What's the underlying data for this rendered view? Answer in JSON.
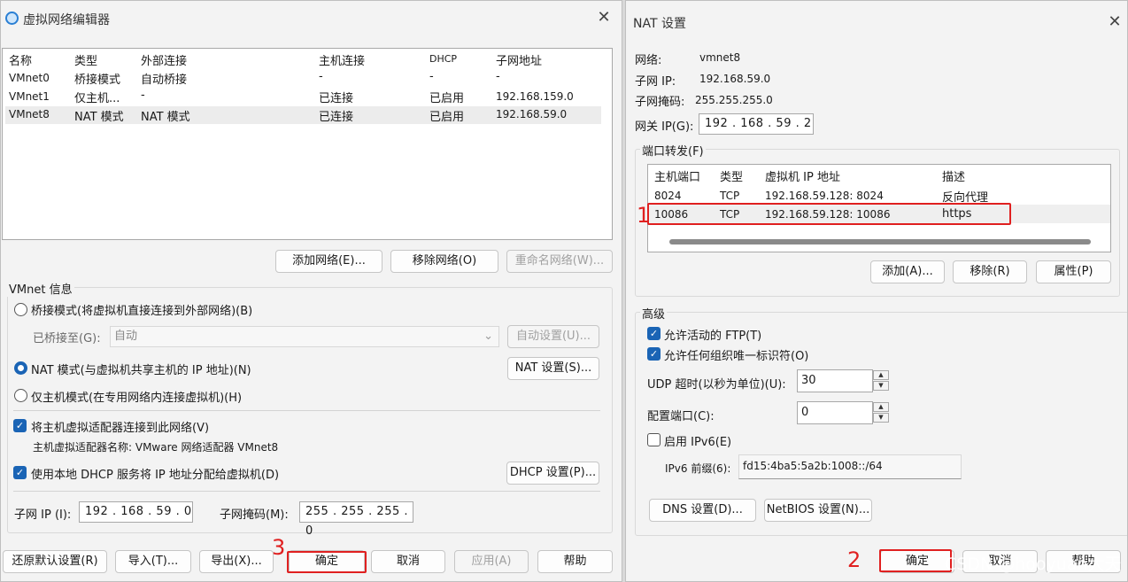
{
  "left": {
    "title": "虚拟网络编辑器",
    "columns": [
      "名称",
      "类型",
      "外部连接",
      "主机连接",
      "DHCP",
      "子网地址"
    ],
    "rows": [
      [
        "VMnet0",
        "桥接模式",
        "自动桥接",
        "-",
        "-",
        "-"
      ],
      [
        "VMnet1",
        "仅主机...",
        "-",
        "已连接",
        "已启用",
        "192.168.159.0"
      ],
      [
        "VMnet8",
        "NAT 模式",
        "NAT 模式",
        "已连接",
        "已启用",
        "192.168.59.0"
      ]
    ],
    "add_network": "添加网络(E)...",
    "remove_network": "移除网络(O)",
    "rename_network": "重命名网络(W)...",
    "vmnet_info": "VMnet 信息",
    "bridge_mode": "桥接模式(将虚拟机直接连接到外部网络)(B)",
    "bridged_to_label": "已桥接至(G):",
    "bridged_to_value": "自动",
    "auto_settings": "自动设置(U)...",
    "nat_mode": "NAT 模式(与虚拟机共享主机的 IP 地址)(N)",
    "nat_settings": "NAT 设置(S)...",
    "host_only_mode": "仅主机模式(在专用网络内连接虚拟机)(H)",
    "connect_host_adapter": "将主机虚拟适配器连接到此网络(V)",
    "host_adapter_name": "主机虚拟适配器名称: VMware 网络适配器 VMnet8",
    "use_dhcp": "使用本地 DHCP 服务将 IP 地址分配给虚拟机(D)",
    "dhcp_settings": "DHCP 设置(P)...",
    "subnet_ip_label": "子网 IP (I):",
    "subnet_ip": "192 . 168 . 59 . 0",
    "subnet_mask_label": "子网掩码(M):",
    "subnet_mask": "255 . 255 . 255 . 0",
    "restore_defaults": "还原默认设置(R)",
    "import": "导入(T)...",
    "export": "导出(X)...",
    "ok": "确定",
    "cancel": "取消",
    "apply": "应用(A)",
    "help": "帮助"
  },
  "right": {
    "title": "NAT 设置",
    "network_label": "网络:",
    "network_value": "vmnet8",
    "subnet_ip_label": "子网 IP:",
    "subnet_ip_value": "192.168.59.0",
    "subnet_mask_label": "子网掩码:",
    "subnet_mask_value": "255.255.255.0",
    "gateway_label": "网关 IP(G):",
    "gateway_value": "192 . 168 . 59 . 2",
    "port_forwarding": "端口转发(F)",
    "pf_columns": [
      "主机端口",
      "类型",
      "虚拟机 IP 地址",
      "描述"
    ],
    "pf_rows": [
      [
        "8024",
        "TCP",
        "192.168.59.128: 8024",
        "反向代理"
      ],
      [
        "10086",
        "TCP",
        "192.168.59.128: 10086",
        "https"
      ]
    ],
    "add": "添加(A)...",
    "remove": "移除(R)",
    "properties": "属性(P)",
    "advanced": "高级",
    "allow_active_ftp": "允许活动的 FTP(T)",
    "allow_org_id": "允许任何组织唯一标识符(O)",
    "udp_timeout_label": "UDP 超时(以秒为单位)(U):",
    "udp_timeout_value": "30",
    "config_port_label": "配置端口(C):",
    "config_port_value": "0",
    "enable_ipv6": "启用 IPv6(E)",
    "ipv6_prefix_label": "IPv6 前缀(6):",
    "ipv6_prefix_value": "fd15:4ba5:5a2b:1008::/64",
    "dns_settings": "DNS 设置(D)...",
    "netbios_settings": "NetBIOS 设置(N)...",
    "ok": "确定",
    "cancel": "取消",
    "help": "帮助"
  },
  "annotations": {
    "one": "1",
    "two": "2",
    "three": "3"
  },
  "watermark": "CSDN @hooyuan大天",
  "colors": {
    "accent": "#1a64b5",
    "highlight": "#e02020"
  }
}
